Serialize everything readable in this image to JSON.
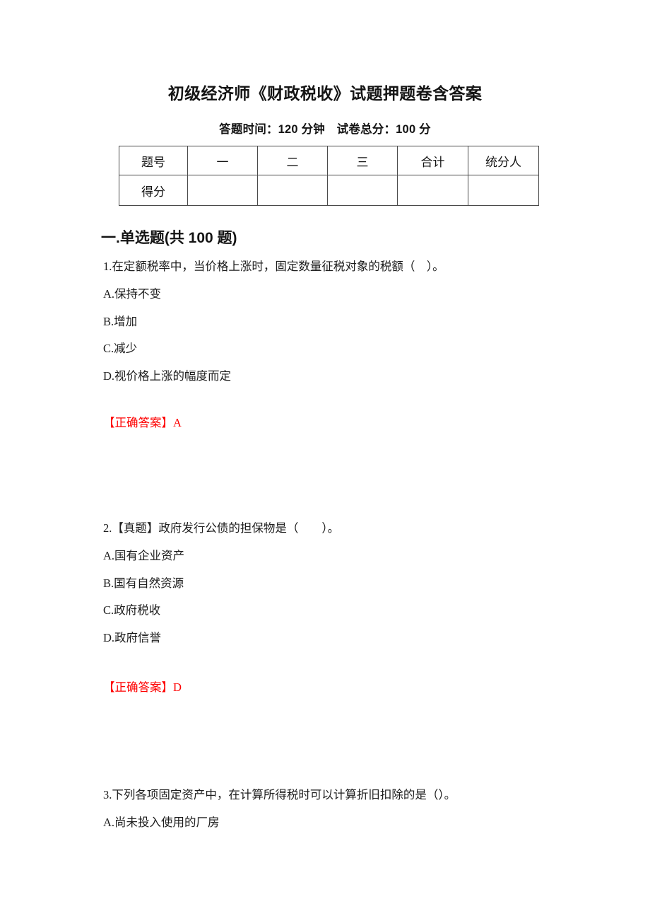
{
  "document": {
    "title": "初级经济师《财政税收》试题押题卷含答案",
    "subtitle": "答题时间：120 分钟　试卷总分：100 分"
  },
  "score_table": {
    "headers": [
      "题号",
      "一",
      "二",
      "三",
      "合计",
      "统分人"
    ],
    "rows": [
      {
        "label": "得分",
        "cells": [
          "",
          "",
          "",
          "",
          ""
        ]
      }
    ]
  },
  "sections": [
    {
      "heading": "一.单选题(共 100 题)"
    }
  ],
  "questions": [
    {
      "stem": "1.在定额税率中，当价格上涨时，固定数量征税对象的税额（　）。",
      "options": [
        "A.保持不变",
        "B.增加",
        "C.减少",
        "D.视价格上涨的幅度而定"
      ],
      "answer_label": "【正确答案】",
      "answer_value": "A"
    },
    {
      "stem": "2.【真题】政府发行公债的担保物是（　　）。",
      "options": [
        "A.国有企业资产",
        "B.国有自然资源",
        "C.政府税收",
        "D.政府信誉"
      ],
      "answer_label": "【正确答案】",
      "answer_value": "D"
    },
    {
      "stem": "3.下列各项固定资产中，在计算所得税时可以计算折旧扣除的是（）。",
      "options": [
        "A.尚未投入使用的厂房"
      ],
      "answer_label": "",
      "answer_value": ""
    }
  ],
  "colors": {
    "answer_red": "#fe0000",
    "text": "#1d1d1d",
    "table_border": "#4a4a4a"
  }
}
